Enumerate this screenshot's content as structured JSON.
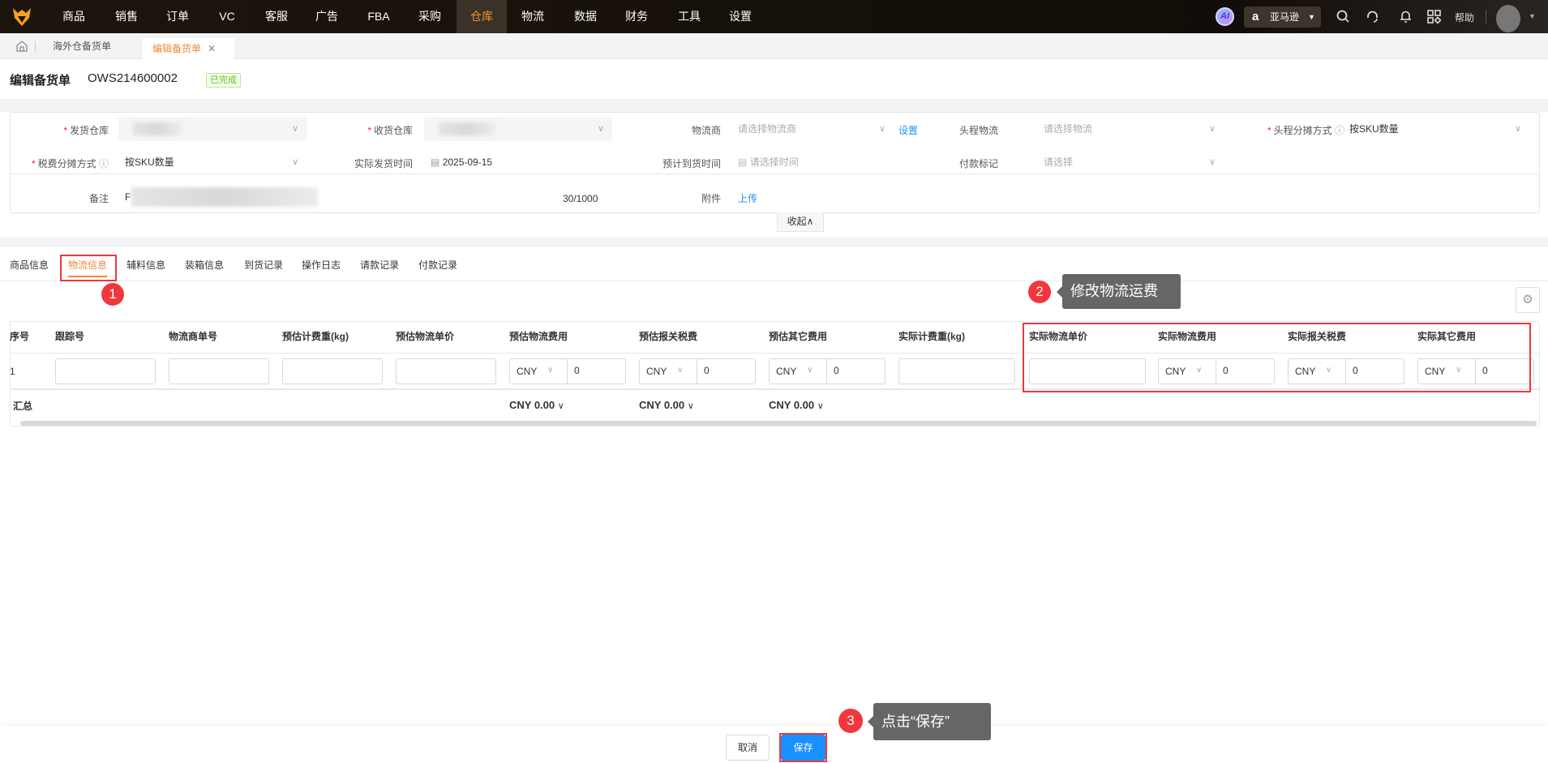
{
  "nav": {
    "items": [
      "商品",
      "销售",
      "订单",
      "VC",
      "客服",
      "广告",
      "FBA",
      "采购",
      "仓库",
      "物流",
      "数据",
      "财务",
      "工具",
      "设置"
    ],
    "active": "仓库",
    "ai": "AI",
    "platform": "亚马逊",
    "help": "帮助"
  },
  "page_tabs": {
    "tab1": "海外仓备货单",
    "tab2": "编辑备货单"
  },
  "header": {
    "title": "编辑备货单",
    "order_no": "OWS214600002",
    "status": "已完成"
  },
  "form": {
    "ship_wh_label": "发货仓库",
    "recv_wh_label": "收货仓库",
    "carrier_label": "物流商",
    "carrier_ph": "请选择物流商",
    "carrier_set": "设置",
    "first_leg_label": "头程物流",
    "first_leg_ph": "请选择物流",
    "first_alloc_label": "头程分摊方式",
    "first_alloc_value": "按SKU数量",
    "tax_alloc_label": "税费分摊方式",
    "tax_alloc_value": "按SKU数量",
    "ship_date_label": "实际发货时间",
    "ship_date_value": "2025-09-15",
    "eta_label": "预计到货时间",
    "eta_ph": "请选择时间",
    "pay_label": "付款标记",
    "pay_ph": "请选择",
    "remark_label": "备注",
    "remark_prefix": "F",
    "remark_count": "30/1000",
    "attach_label": "附件",
    "attach_link": "上传",
    "collapse": "收起"
  },
  "tabs": [
    "商品信息",
    "物流信息",
    "辅料信息",
    "装箱信息",
    "到货记录",
    "操作日志",
    "请款记录",
    "付款记录"
  ],
  "table": {
    "headers": [
      "序号",
      "跟踪号",
      "物流商单号",
      "预估计费重(kg)",
      "预估物流单价",
      "预估物流费用",
      "预估报关税费",
      "预估其它费用",
      "实际计费重(kg)",
      "实际物流单价",
      "实际物流费用",
      "实际报关税费",
      "实际其它费用"
    ],
    "row": {
      "index": "1",
      "currency": "CNY",
      "amount": "0"
    },
    "summary_label": "汇总",
    "summary": [
      "CNY 0.00",
      "CNY 0.00",
      "CNY 0.00"
    ]
  },
  "annotations": {
    "step1": "1",
    "step2": "2",
    "step2_text": "修改物流运费",
    "step3": "3",
    "step3_text": "点击“保存”"
  },
  "footer": {
    "cancel": "取消",
    "save": "保存"
  },
  "colors": {
    "accent": "#f0883a",
    "primary": "#1890ff",
    "annotation": "#f0373d"
  }
}
